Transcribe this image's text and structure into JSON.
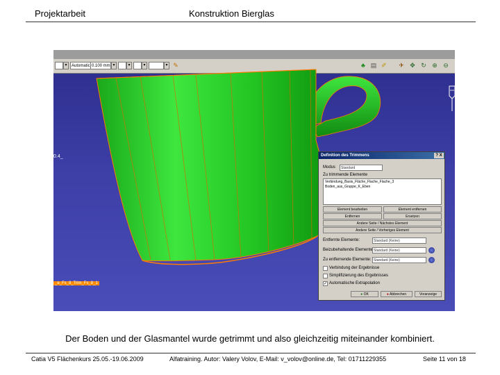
{
  "header": {
    "left_title": "Projektarbeit",
    "center_title": "Konstruktion   Bierglas"
  },
  "screenshot": {
    "toolbar": {
      "field1": "",
      "field2": "Automatic",
      "field3": "0.100 mm",
      "field4": "",
      "field5": ""
    },
    "viewport": {
      "cup_label": "0.4_",
      "tree_label": "_e_Fs_8_Trim_Fs_8_1",
      "cup_color": "#22d222",
      "edge_color": "#ff7a00"
    },
    "dialog": {
      "title": "Definition des Trimmens",
      "close_label": "?  X",
      "modus_label": "Modus",
      "modus_value": "Standard",
      "elements_label": "Zu trimmende Elemente",
      "elements": [
        "Verbindung_Basis_Fläche_Flache_Flache_3",
        "Boden_aus_Gruppe_K_Eben"
      ],
      "buttons": [
        "Element bearbeiten",
        "Element entfernen",
        "Entfernen",
        "Ersetzen",
        "Andere Seite / Nächstes Element",
        "Andere Seite / Vorheriges Element"
      ],
      "row1_label": "Entfernte Elemente:",
      "row1_value": "Standard (Keine)",
      "row2_label": "Beizubehaltende Elemente:",
      "row2_value": "Standard (Keine)",
      "row3_label": "Zu entfernende Elemente:",
      "row3_value": "Standard (Keine)",
      "check1": "Verbindung der Ergebnisse",
      "check2": "Simplifizierung des Ergebnisses",
      "check3": "Automatische Extrapolation",
      "ok_label": "OK",
      "cancel_label": "Abbrechen",
      "preview_label": "Voranzeige"
    }
  },
  "caption": "Der Boden und der Glasmantel wurde getrimmt und also gleichzeitig miteinander kombiniert.",
  "footer": {
    "left": "Catia V5 Flächenkurs 25.05.-19.06.2009",
    "center": "Alfatraining. Autor: Valery Volov, E-Mail: v_volov@online.de, Tel: 01711229355",
    "right": "Seite 11 von 18"
  }
}
